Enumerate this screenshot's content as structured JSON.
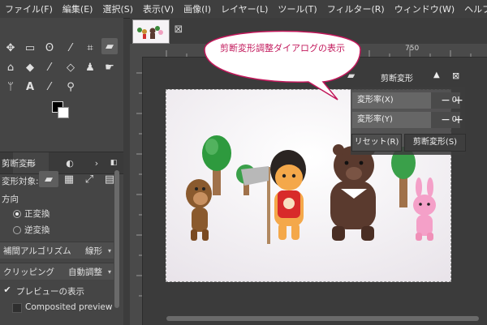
{
  "menubar": {
    "items": [
      "ファイル(F)",
      "編集(E)",
      "選択(S)",
      "表示(V)",
      "画像(I)",
      "レイヤー(L)",
      "ツール(T)",
      "フィルター(R)",
      "ウィンドウ(W)",
      "ヘルプ(H)"
    ]
  },
  "image_tab": {
    "close_icon": "close-icon"
  },
  "ruler": {
    "label_750": "750"
  },
  "tool_options": {
    "title": "剪断変形",
    "transform_label": "変形対象:",
    "direction_label": "方向",
    "direction_forward": "正変換",
    "direction_backward": "逆変換",
    "interpolation_label": "補間アルゴリズム",
    "interpolation_value": "線形",
    "clipping_label": "クリッピング",
    "clipping_value": "自動調整",
    "preview_label": "プレビューの表示",
    "preview_checked": true,
    "composited_label": "Composited preview",
    "composited_checked": false
  },
  "shear_dialog": {
    "title": "剪断変形",
    "shear_x_label": "変形率(X)",
    "shear_x_value": "0",
    "shear_y_label": "変形率(Y)",
    "shear_y_value": "0",
    "reset_label": "リセット(R)",
    "apply_label": "剪断変形(S)"
  },
  "callout": {
    "text": "剪断変形調整ダイアログの表示"
  },
  "colors": {
    "callout_border": "#c2185b",
    "callout_text": "#c2185b",
    "foreground": "#000000",
    "background": "#ffffff"
  }
}
